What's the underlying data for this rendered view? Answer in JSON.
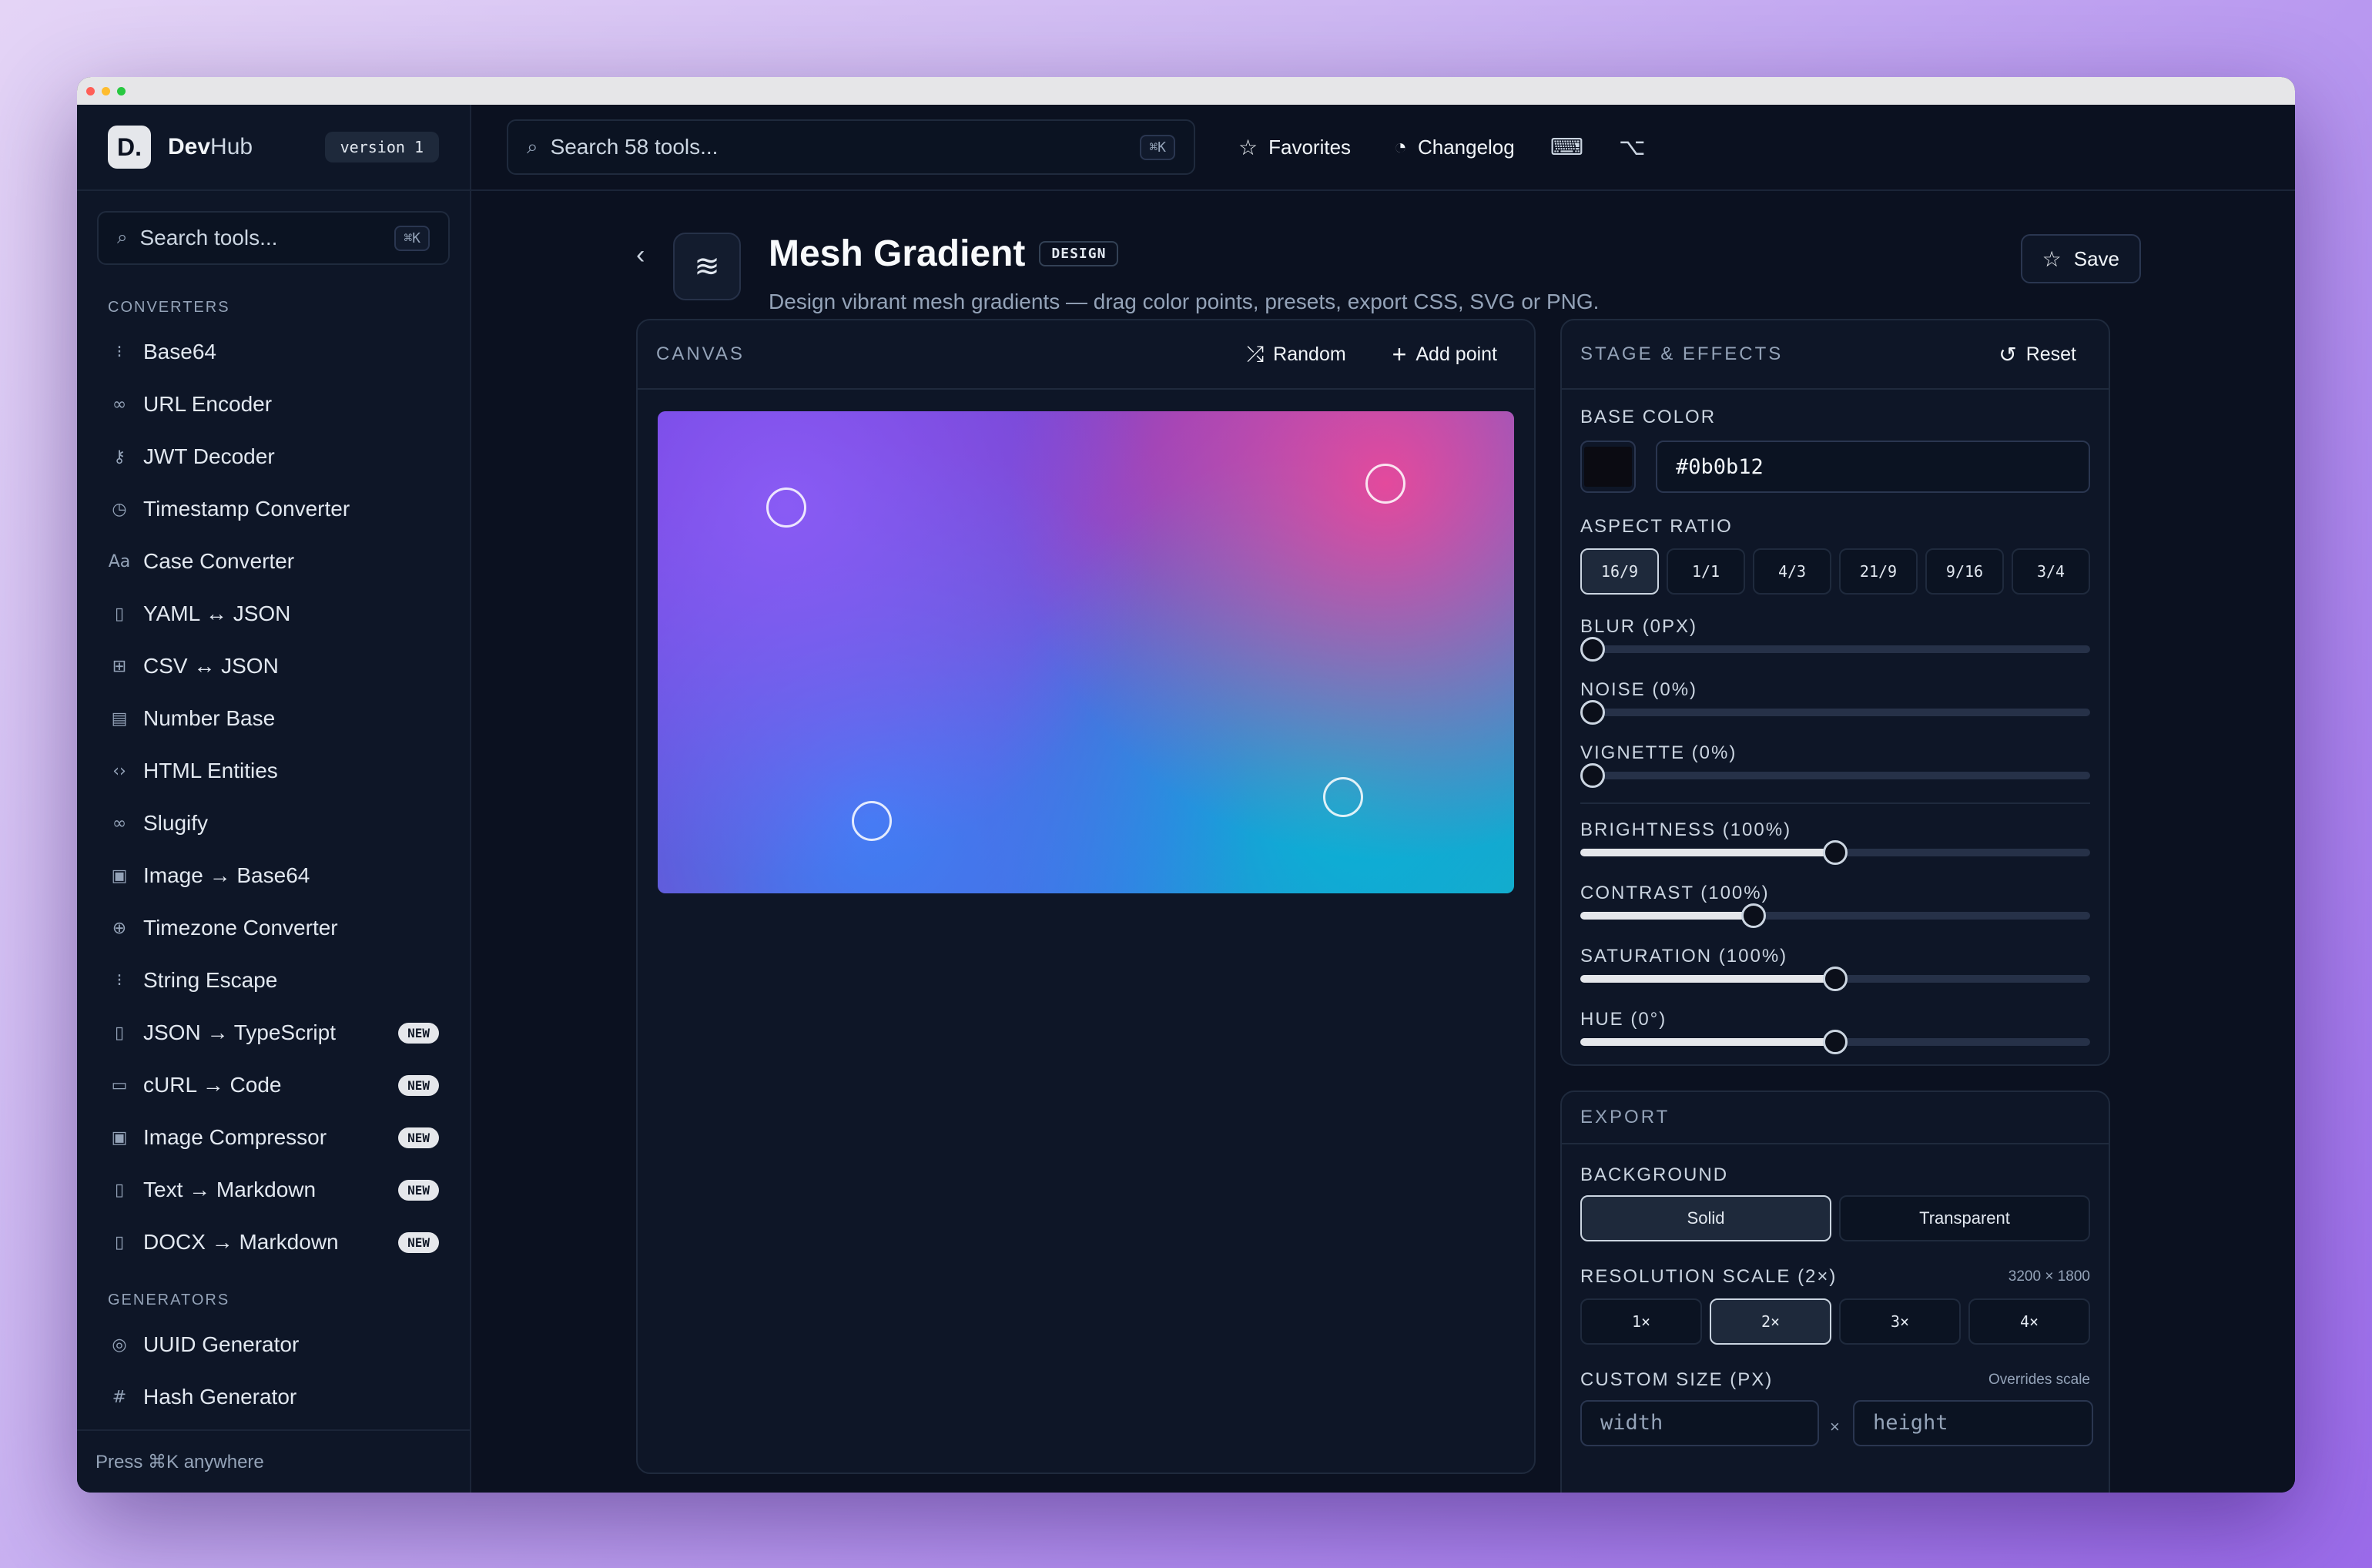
{
  "window": {
    "dots": [
      "#ff5f57",
      "#febc2e",
      "#28c840"
    ]
  },
  "brand": {
    "logo": "D.",
    "name_bold": "Dev",
    "name_rest": "Hub",
    "version": "version 1"
  },
  "sidebar": {
    "search_placeholder": "Search tools...",
    "search_kbd": "⌘K",
    "sections": [
      {
        "label": "CONVERTERS",
        "items": [
          {
            "icon": "binary-icon",
            "glyph": "⁝",
            "label": "Base64"
          },
          {
            "icon": "link-icon",
            "glyph": "∞",
            "label": "URL Encoder"
          },
          {
            "icon": "key-icon",
            "glyph": "⚷",
            "label": "JWT Decoder"
          },
          {
            "icon": "clock-icon",
            "glyph": "◷",
            "label": "Timestamp Converter"
          },
          {
            "icon": "case-icon",
            "glyph": "Aa",
            "label": "Case Converter"
          },
          {
            "icon": "file-code-icon",
            "glyph": "▯",
            "label": "YAML ↔ JSON"
          },
          {
            "icon": "table-icon",
            "glyph": "⊞",
            "label": "CSV ↔ JSON"
          },
          {
            "icon": "calculator-icon",
            "glyph": "▤",
            "label": "Number Base"
          },
          {
            "icon": "code-icon",
            "glyph": "‹›",
            "label": "HTML Entities"
          },
          {
            "icon": "chain-link-icon",
            "glyph": "∞",
            "label": "Slugify"
          },
          {
            "icon": "image-icon",
            "glyph": "▣",
            "label": "Image → Base64"
          },
          {
            "icon": "globe-icon",
            "glyph": "⊕",
            "label": "Timezone Converter"
          },
          {
            "icon": "binary-icon",
            "glyph": "⁝",
            "label": "String Escape"
          },
          {
            "icon": "file-code-icon",
            "glyph": "▯",
            "label": "JSON → TypeScript",
            "badge": "NEW"
          },
          {
            "icon": "terminal-icon",
            "glyph": "▭",
            "label": "cURL → Code",
            "badge": "NEW"
          },
          {
            "icon": "image-icon",
            "glyph": "▣",
            "label": "Image Compressor",
            "badge": "NEW"
          },
          {
            "icon": "file-text-icon",
            "glyph": "▯",
            "label": "Text → Markdown",
            "badge": "NEW"
          },
          {
            "icon": "file-text-icon",
            "glyph": "▯",
            "label": "DOCX → Markdown",
            "badge": "NEW"
          }
        ]
      },
      {
        "label": "GENERATORS",
        "items": [
          {
            "icon": "fingerprint-icon",
            "glyph": "◎",
            "label": "UUID Generator"
          },
          {
            "icon": "hash-icon",
            "glyph": "#",
            "label": "Hash Generator"
          }
        ]
      }
    ],
    "footer": "Press ⌘K anywhere"
  },
  "topbar": {
    "search_placeholder": "Search 58 tools...",
    "search_kbd": "⌘K",
    "favorites": "Favorites",
    "changelog": "Changelog"
  },
  "tool": {
    "title": "Mesh Gradient",
    "category": "DESIGN",
    "description": "Design vibrant mesh gradients — drag color points, presets, export CSS, SVG or PNG.",
    "save": "Save"
  },
  "canvas": {
    "title": "CANVAS",
    "random": "Random",
    "add_point": "Add point",
    "points": [
      {
        "color": "#8b5cf6"
      },
      {
        "color": "#ec4899"
      },
      {
        "color": "#3b82f6"
      },
      {
        "color": "#06b6d4"
      }
    ]
  },
  "effects": {
    "title": "STAGE & EFFECTS",
    "reset": "Reset",
    "base_color_label": "BASE COLOR",
    "base_color": "#0b0b12",
    "aspect_label": "ASPECT RATIO",
    "aspect_options": [
      "16/9",
      "1/1",
      "4/3",
      "21/9",
      "9/16",
      "3/4"
    ],
    "aspect_selected": "16/9",
    "sliders": [
      {
        "label": "BLUR (0PX)",
        "value": 0
      },
      {
        "label": "NOISE (0%)",
        "value": 0
      },
      {
        "label": "VIGNETTE (0%)",
        "value": 0
      },
      {
        "label": "BRIGHTNESS (100%)",
        "value": 0.5
      },
      {
        "label": "CONTRAST (100%)",
        "value": 0.34
      },
      {
        "label": "SATURATION (100%)",
        "value": 0.5
      },
      {
        "label": "HUE (0°)",
        "value": 0.5
      }
    ]
  },
  "export": {
    "title": "EXPORT",
    "background_label": "BACKGROUND",
    "background_options": [
      "Solid",
      "Transparent"
    ],
    "background_selected": "Solid",
    "resolution_label": "RESOLUTION SCALE (2×)",
    "resolution_meta": "3200 × 1800",
    "scale_options": [
      "1×",
      "2×",
      "3×",
      "4×"
    ],
    "scale_selected": "2×",
    "custom_label": "CUSTOM SIZE (PX)",
    "custom_meta": "Overrides scale",
    "width_placeholder": "width",
    "height_placeholder": "height",
    "times": "×"
  }
}
